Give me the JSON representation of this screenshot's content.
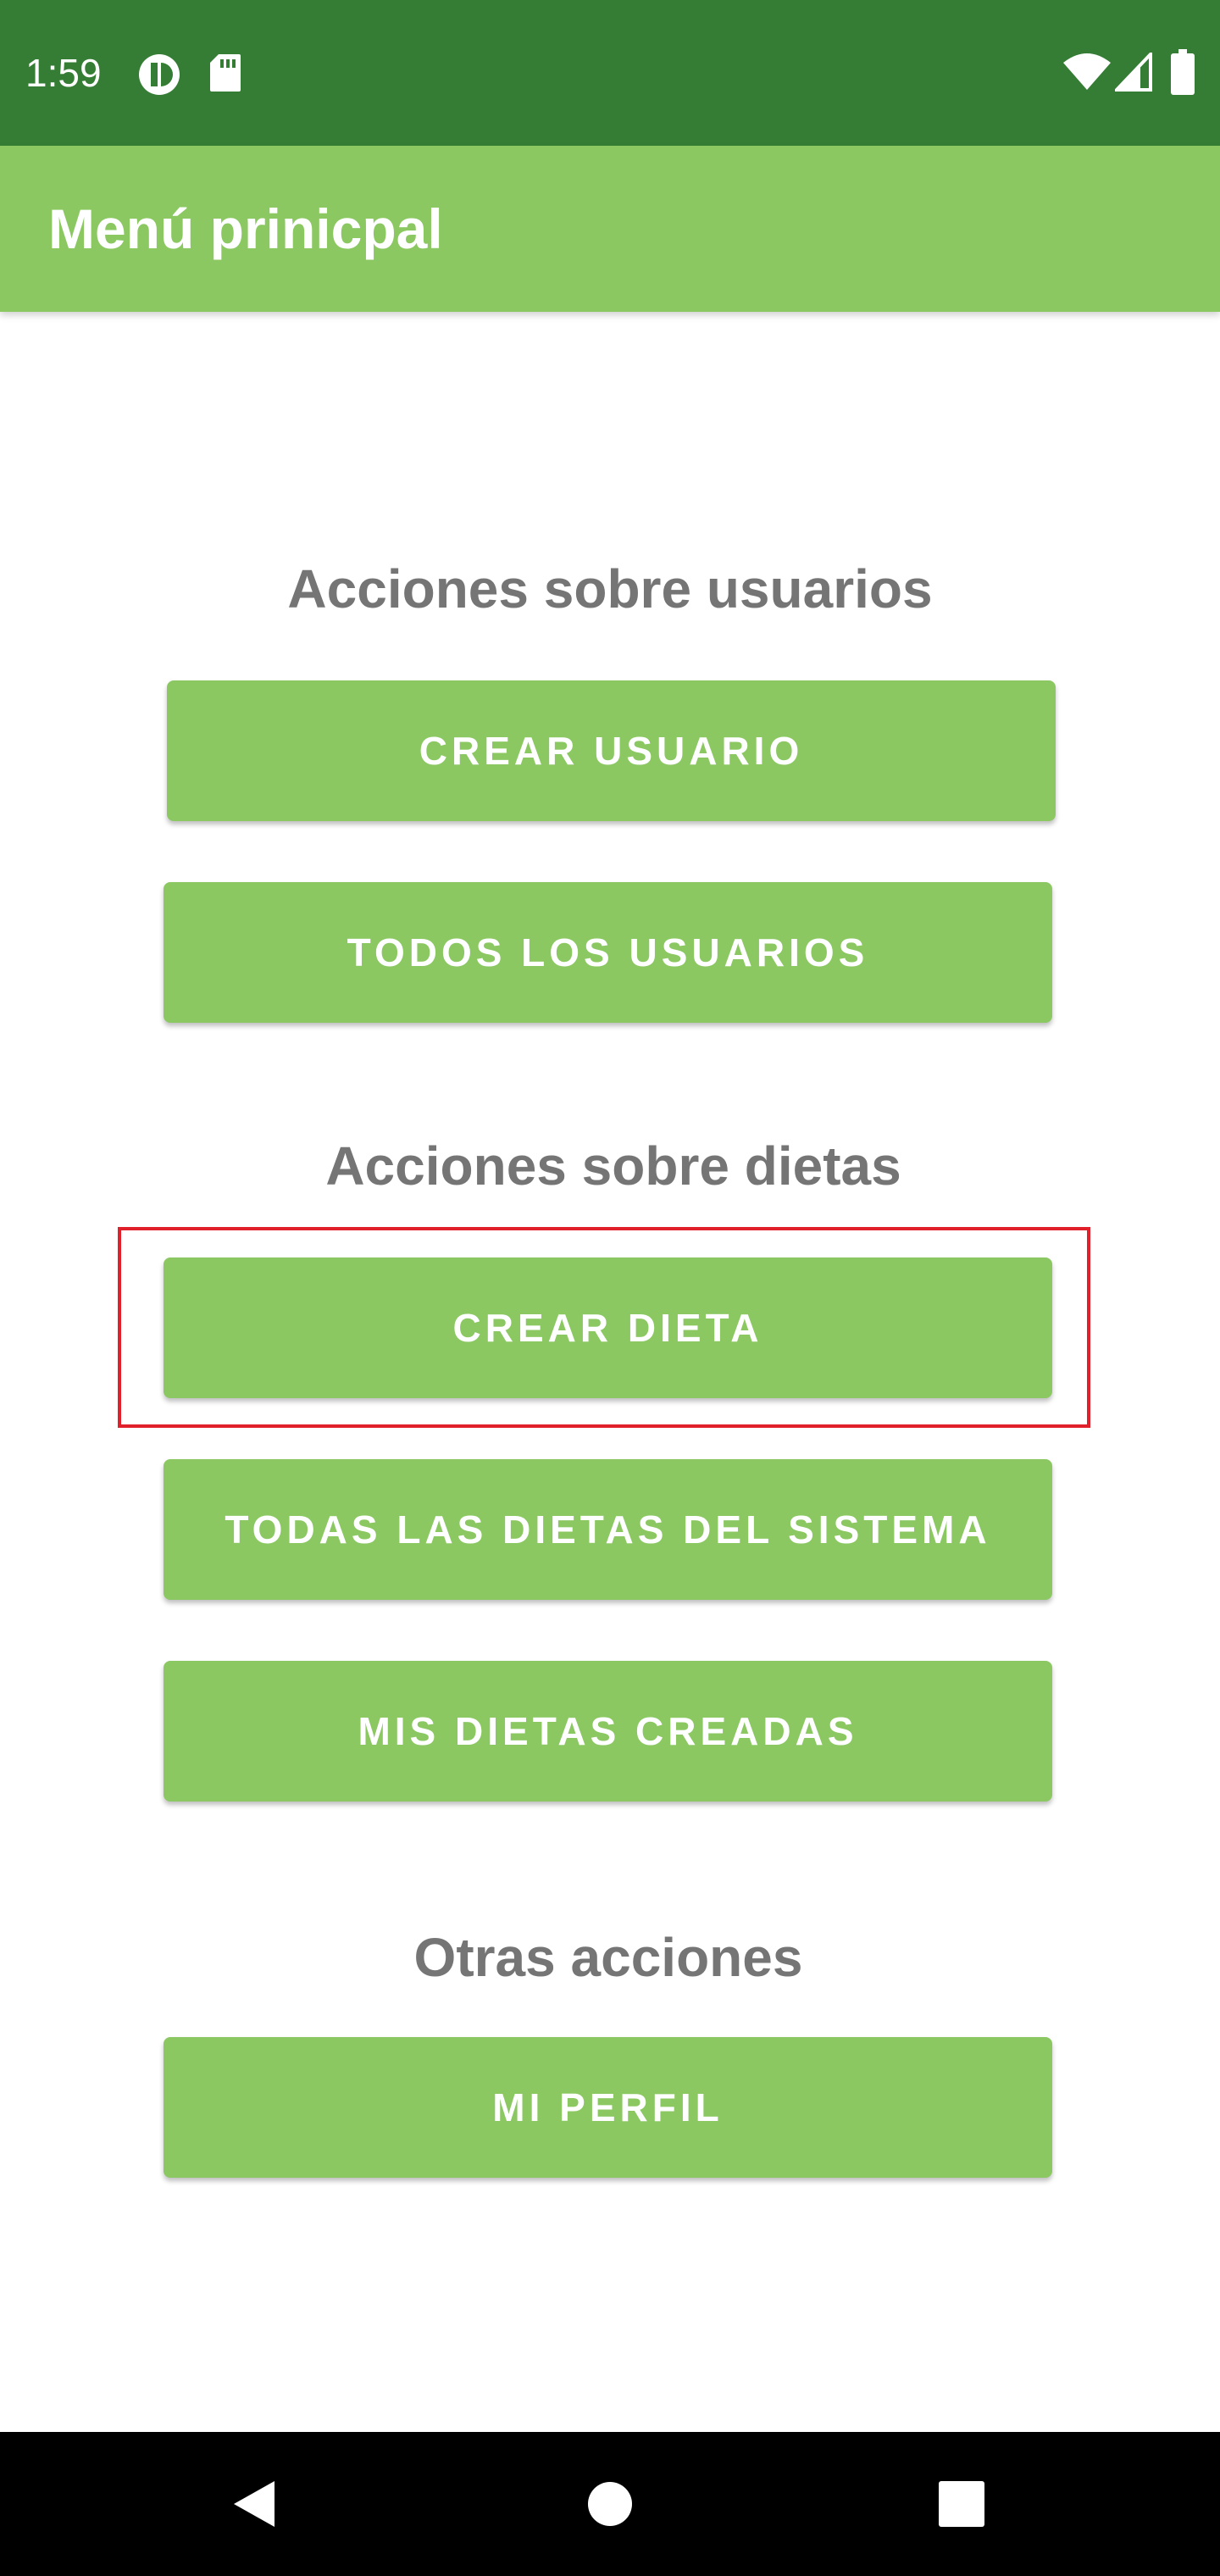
{
  "status_bar": {
    "time": "1:59",
    "icons_left": [
      "app-notification-icon",
      "sd-card-icon"
    ],
    "icons_right": [
      "wifi-icon",
      "cell-signal-icon",
      "battery-icon"
    ]
  },
  "app_bar": {
    "title": "Menú prinicpal"
  },
  "sections": {
    "users": {
      "heading": "Acciones sobre usuarios",
      "create_user": "CREAR USUARIO",
      "all_users": "TODOS LOS USUARIOS"
    },
    "diets": {
      "heading": "Acciones sobre dietas",
      "create_diet": "CREAR DIETA",
      "all_diets": "TODAS LAS DIETAS DEL SISTEMA",
      "my_diets": "MIS DIETAS CREADAS"
    },
    "other": {
      "heading": "Otras acciones",
      "my_profile": "MI PERFIL"
    }
  },
  "nav_bar": {
    "icons": [
      "back-icon",
      "home-icon",
      "recents-icon"
    ]
  },
  "colors": {
    "status_bar": "#357d34",
    "app_bar": "#8bc862",
    "button": "#8bc862",
    "heading_text": "#757575",
    "highlight": "#e0202a"
  }
}
